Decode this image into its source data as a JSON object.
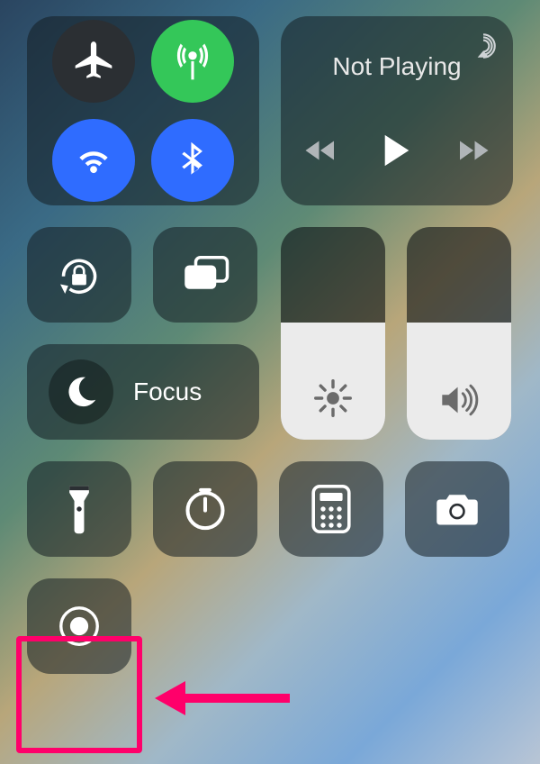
{
  "connectivity": {
    "airplane": {
      "active": false,
      "color": "#2b2f33"
    },
    "cellular": {
      "active": true,
      "color": "#34c759"
    },
    "wifi": {
      "active": true,
      "color": "#2f6cff"
    },
    "bluetooth": {
      "active": true,
      "color": "#2f6cff"
    }
  },
  "media": {
    "title": "Not Playing"
  },
  "focus": {
    "label": "Focus"
  },
  "brightness": {
    "level_percent": 55
  },
  "volume": {
    "level_percent": 55
  },
  "tiles": {
    "orientation_lock": "orientation-lock",
    "screen_mirroring": "screen-mirroring",
    "flashlight": "flashlight",
    "timer": "timer",
    "calculator": "calculator",
    "camera": "camera",
    "screen_recording": "screen-recording"
  },
  "annotation": {
    "highlight_color": "#ff006a"
  }
}
